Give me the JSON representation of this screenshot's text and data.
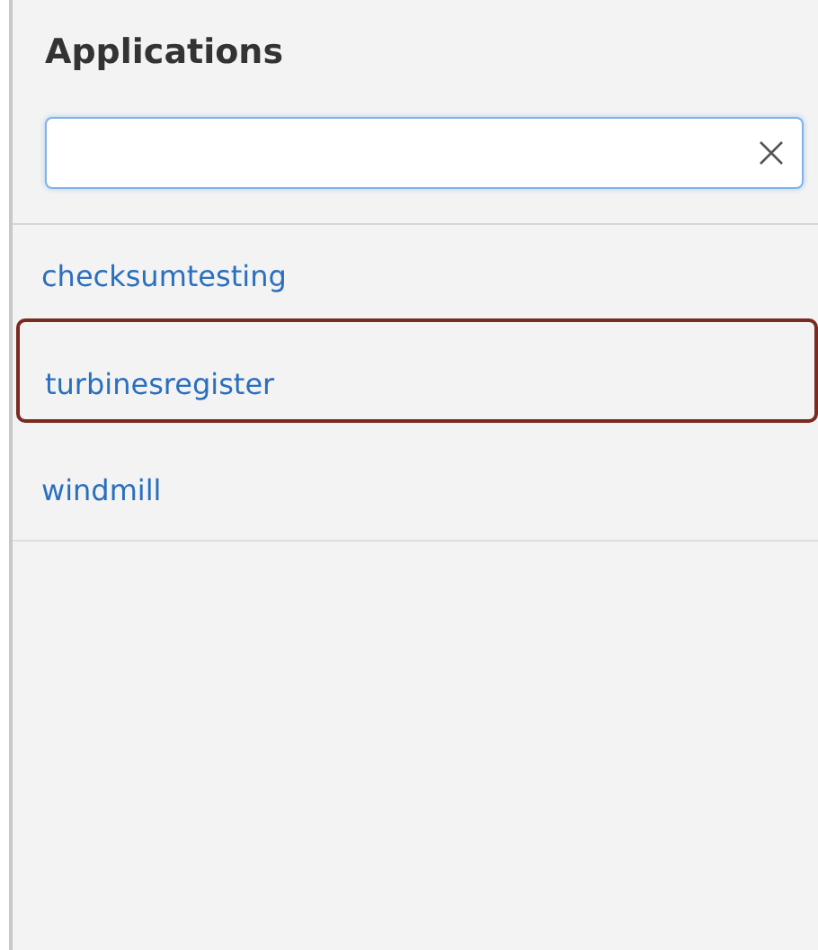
{
  "panel": {
    "title": "Applications"
  },
  "search": {
    "clear_icon": true
  },
  "applications": [
    {
      "label": "checksumtesting",
      "selected": false
    },
    {
      "label": "turbinesregister",
      "selected": true
    },
    {
      "label": "windmill",
      "selected": false
    }
  ]
}
